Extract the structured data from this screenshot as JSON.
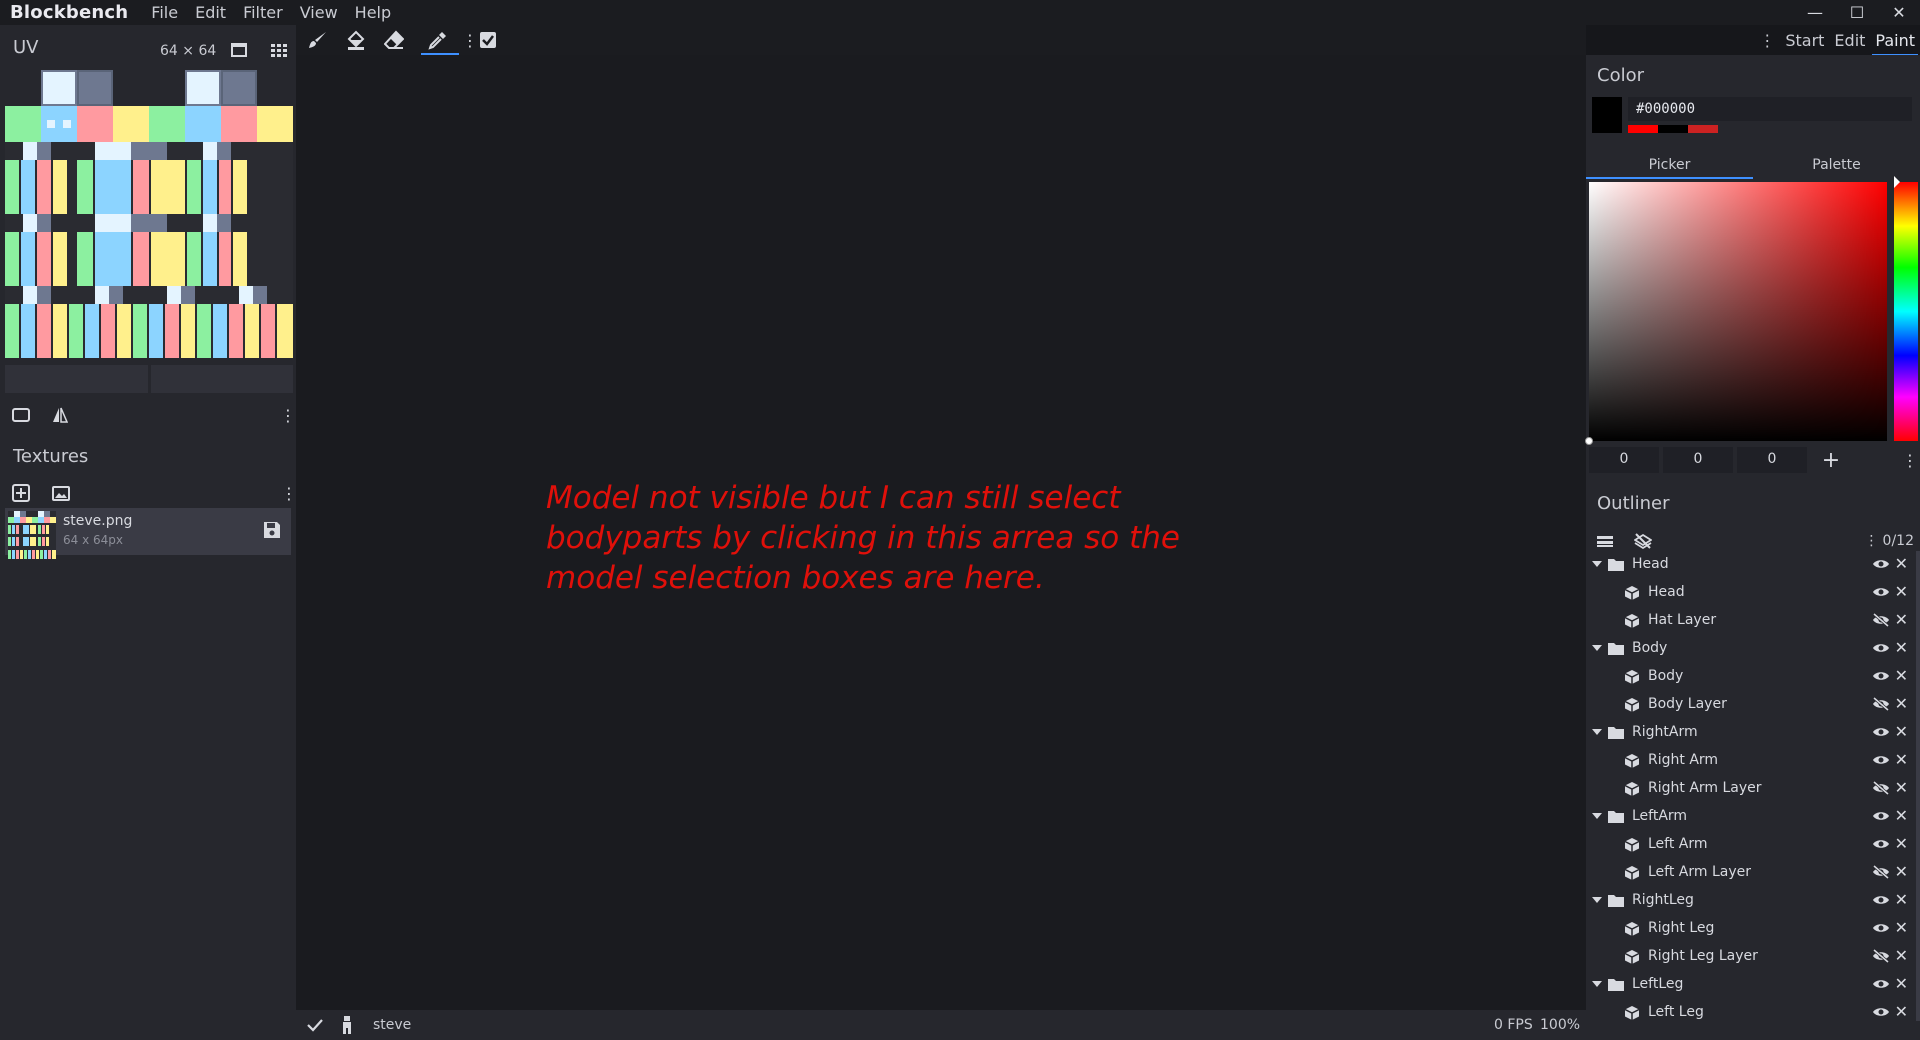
{
  "app": {
    "name": "Blockbench"
  },
  "menu": [
    "File",
    "Edit",
    "Filter",
    "View",
    "Help"
  ],
  "window_controls": {
    "minimize": "—",
    "maximize": "☐",
    "close": "✕"
  },
  "uv_panel": {
    "title": "UV",
    "size_label": "64 ⨯ 64"
  },
  "textures_panel": {
    "title": "Textures",
    "items": [
      {
        "name": "steve.png",
        "dimensions": "64 x 64px"
      }
    ]
  },
  "toolbar": {
    "tools": [
      "brush-icon",
      "fill-bucket-icon",
      "eraser-icon",
      "color-picker-icon",
      "more-icon",
      "checkbox-icon"
    ]
  },
  "mode_tabs": {
    "more": "⋮",
    "items": [
      "Start",
      "Edit",
      "Paint"
    ],
    "active": "Paint"
  },
  "viewport": {
    "annotation": "Model not visible but I can still select bodyparts by clicking in this arrea so the model selection boxes are here."
  },
  "statusbar": {
    "project": "steve",
    "fps": "0 FPS",
    "zoom": "100%"
  },
  "color_panel": {
    "title": "Color",
    "hex": "#000000",
    "tabs": [
      "Picker",
      "Palette"
    ],
    "active_tab": "Picker",
    "rgb": [
      "0",
      "0",
      "0"
    ],
    "add_label": "+",
    "history_colors": [
      "#ff0000",
      "#000000",
      "#cc2222"
    ]
  },
  "outliner": {
    "title": "Outliner",
    "count": "0/12",
    "rows": [
      {
        "type": "group",
        "name": "Head",
        "visible": true
      },
      {
        "type": "cube",
        "name": "Head",
        "visible": true
      },
      {
        "type": "cube",
        "name": "Hat Layer",
        "visible": false
      },
      {
        "type": "group",
        "name": "Body",
        "visible": true
      },
      {
        "type": "cube",
        "name": "Body",
        "visible": true
      },
      {
        "type": "cube",
        "name": "Body Layer",
        "visible": false
      },
      {
        "type": "group",
        "name": "RightArm",
        "visible": true
      },
      {
        "type": "cube",
        "name": "Right Arm",
        "visible": true
      },
      {
        "type": "cube",
        "name": "Right Arm Layer",
        "visible": false
      },
      {
        "type": "group",
        "name": "LeftArm",
        "visible": true
      },
      {
        "type": "cube",
        "name": "Left Arm",
        "visible": true
      },
      {
        "type": "cube",
        "name": "Left Arm Layer",
        "visible": false
      },
      {
        "type": "group",
        "name": "RightLeg",
        "visible": true
      },
      {
        "type": "cube",
        "name": "Right Leg",
        "visible": true
      },
      {
        "type": "cube",
        "name": "Right Leg Layer",
        "visible": false
      },
      {
        "type": "group",
        "name": "LeftLeg",
        "visible": true
      },
      {
        "type": "cube",
        "name": "Left Leg",
        "visible": true
      }
    ]
  }
}
